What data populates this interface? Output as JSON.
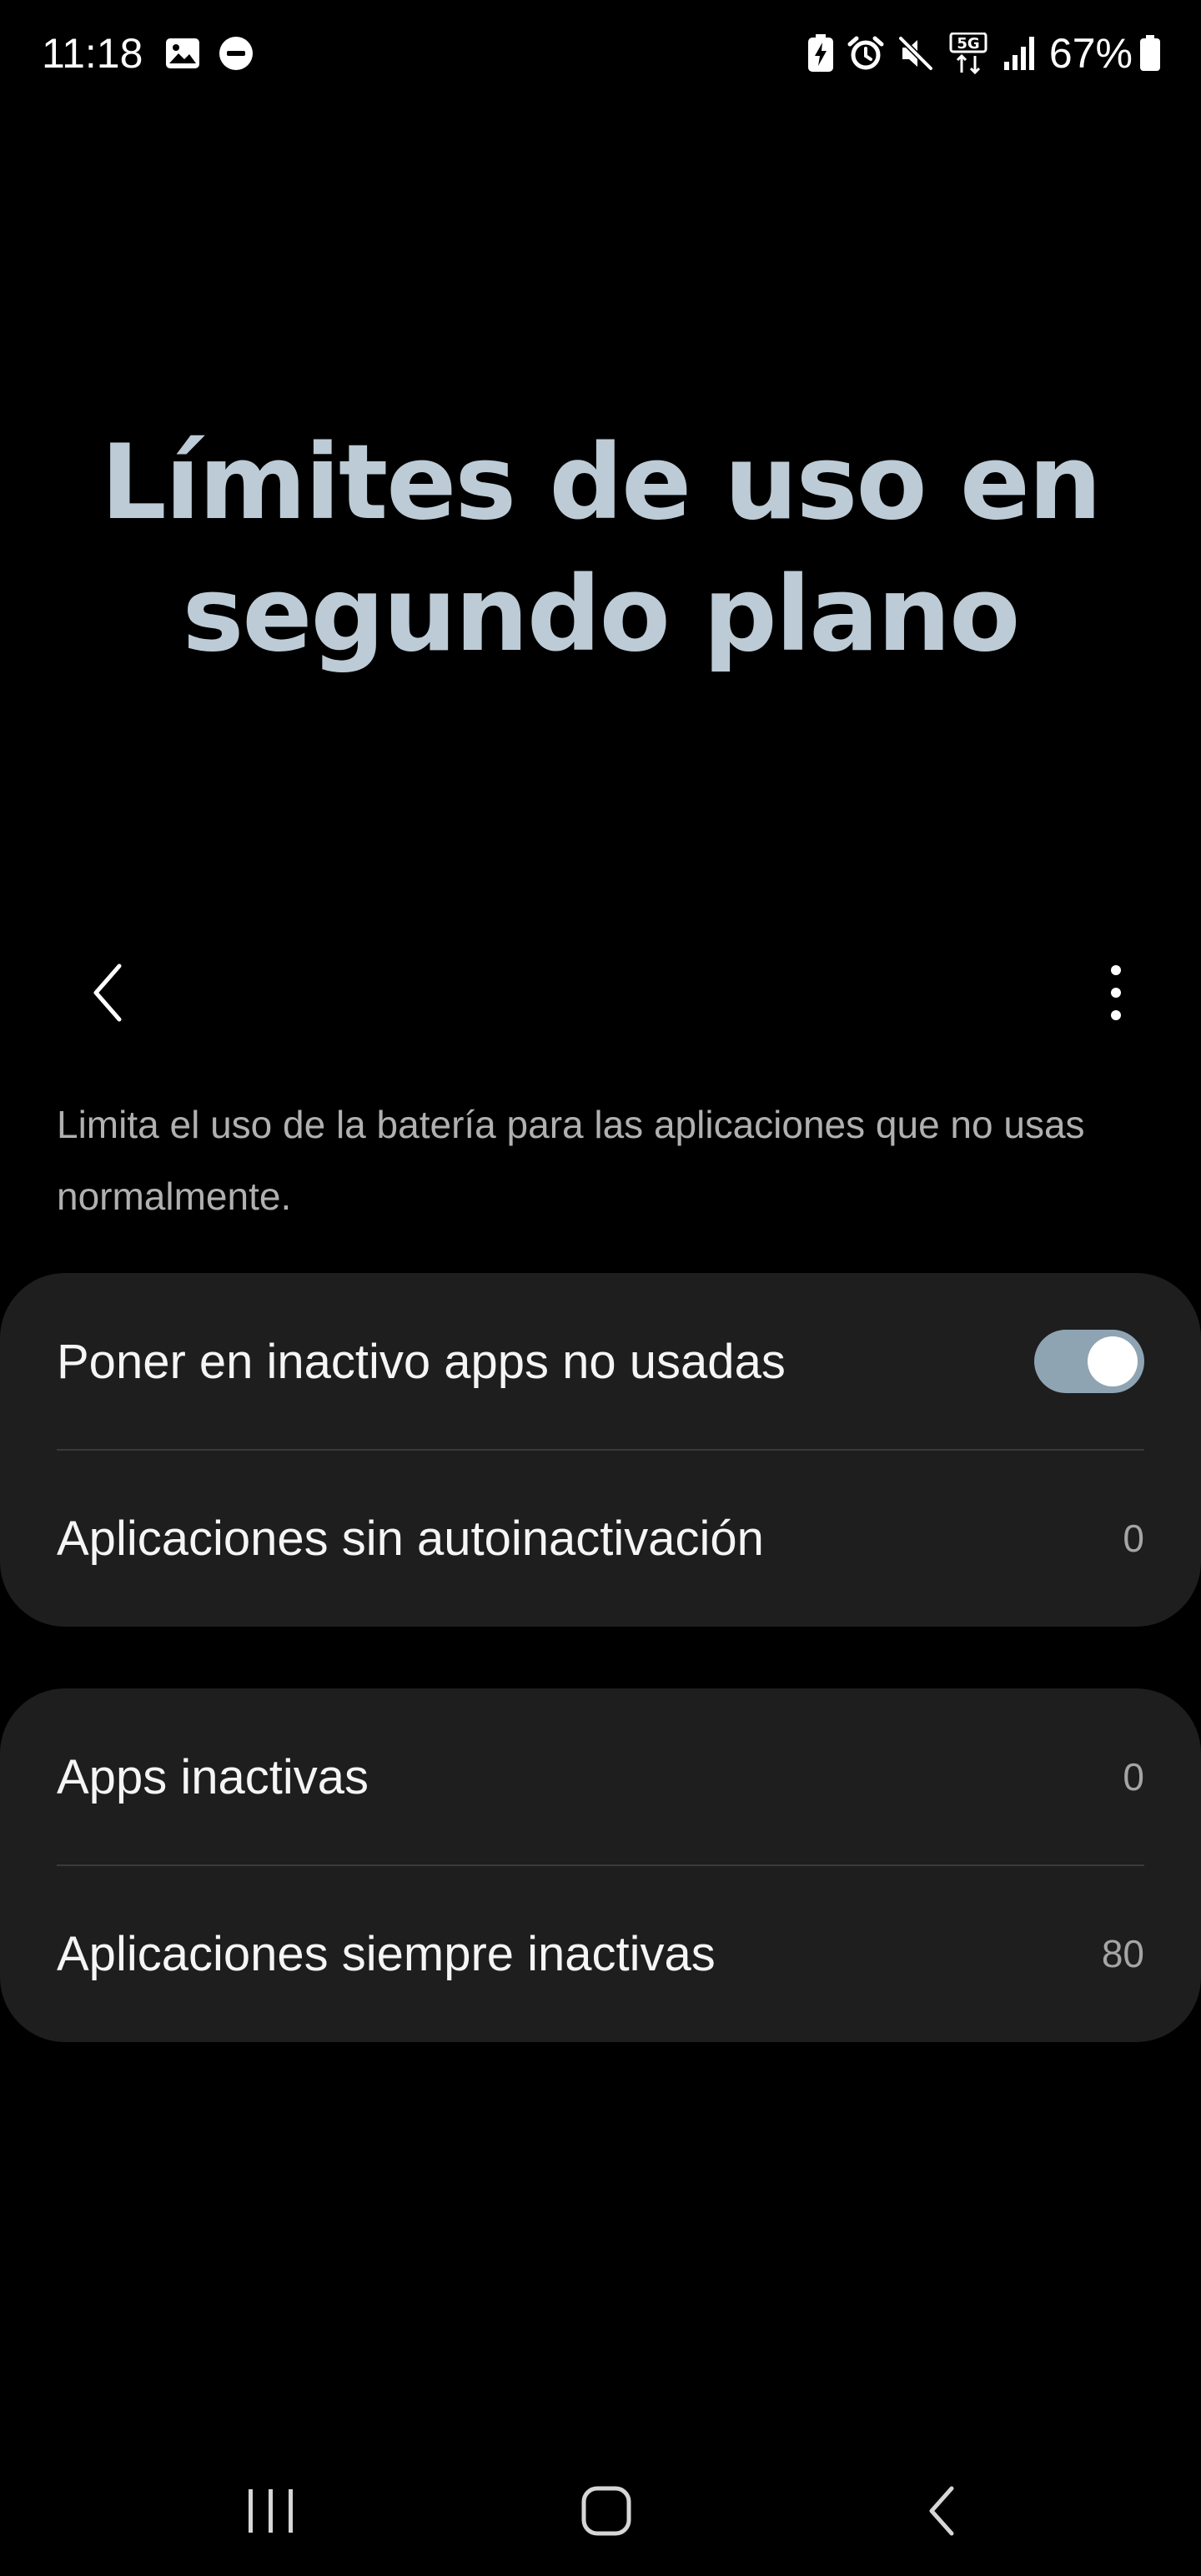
{
  "status_bar": {
    "time": "11:18",
    "left_icons": [
      "gallery-icon",
      "do-not-disturb-icon"
    ],
    "right_icons": [
      "battery-saver-icon",
      "alarm-icon",
      "mute-icon",
      "5g-icon",
      "signal-icon"
    ],
    "battery_text": "67%"
  },
  "header": {
    "title_line1": "Límites de uso en",
    "title_line2": "segundo plano"
  },
  "toolbar": {
    "back_icon": "chevron-left-icon",
    "more_icon": "more-vertical-icon"
  },
  "description": "Limita el uso de la batería para las aplicaciones que no usas normalmente.",
  "card1": {
    "toggle_row": {
      "label": "Poner en inactivo apps no usadas",
      "enabled": true
    },
    "exempt_row": {
      "label": "Aplicaciones sin autoinactivación",
      "value": "0"
    }
  },
  "card2": {
    "sleeping_row": {
      "label": "Apps inactivas",
      "value": "0"
    },
    "deep_sleeping_row": {
      "label": "Aplicaciones siempre inactivas",
      "value": "80"
    }
  },
  "colors": {
    "title": "#bccbd5",
    "toggle_track": "#8fa4b3",
    "card_bg": "#1e1e1e",
    "background": "#000000"
  }
}
